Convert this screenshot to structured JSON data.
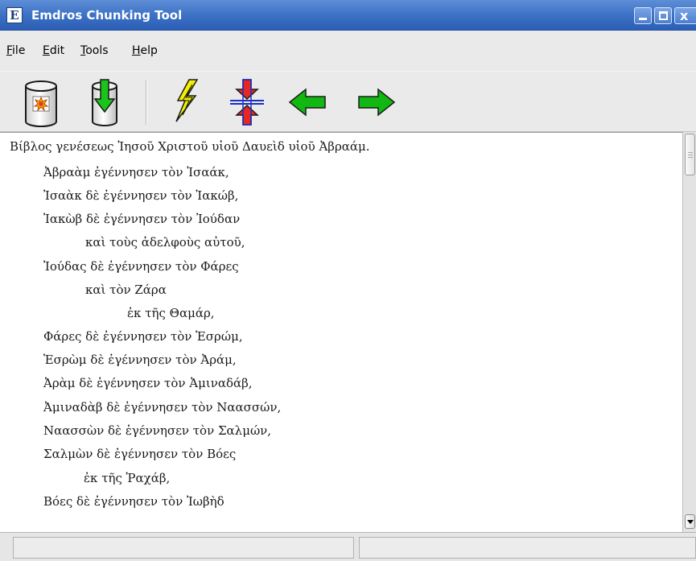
{
  "window": {
    "logo_letter": "E",
    "title": "Emdros Chunking Tool",
    "controls": {
      "close_glyph": "x"
    }
  },
  "menubar": {
    "items": [
      {
        "label": "File",
        "mnemonic": "F",
        "rest": "ile"
      },
      {
        "label": "Edit",
        "mnemonic": "E",
        "rest": "dit"
      },
      {
        "label": "Tools",
        "mnemonic": "T",
        "rest": "ools"
      },
      {
        "label": "Help",
        "mnemonic": "H",
        "rest": "elp"
      }
    ]
  },
  "toolbar": {
    "buttons": [
      {
        "icon": "database-icon"
      },
      {
        "icon": "load-down-arrow-icon"
      },
      {
        "icon": "lightning-icon"
      },
      {
        "icon": "split-merge-arrows-icon"
      },
      {
        "icon": "back-arrow-icon"
      },
      {
        "icon": "forward-arrow-icon"
      }
    ],
    "colors": {
      "arrow_green": "#11b811",
      "lightning_yellow": "#f5f000",
      "split_red": "#e42828",
      "split_blue": "#1b2fc4"
    }
  },
  "text": {
    "lines": [
      {
        "text": "Βίβλος γενέσεως Ἰησοῦ Χριστοῦ υἱοῦ Δαυεὶδ υἱοῦ Ἀβραάμ.",
        "indent": 0
      },
      {
        "text": "Ἀβραὰμ ἐγέννησεν τὸν Ἰσαάκ,",
        "indent": 1
      },
      {
        "text": "Ἰσαὰκ δὲ ἐγέννησεν τὸν Ἰακώβ,",
        "indent": 1
      },
      {
        "text": "Ἰακὼβ δὲ ἐγέννησεν τὸν Ἰούδαν",
        "indent": 1
      },
      {
        "text": "καὶ τοὺς ἀδελφοὺς αὐτοῦ,",
        "indent": 2
      },
      {
        "text": "Ἰούδας δὲ ἐγέννησεν τὸν Φάρες",
        "indent": 1
      },
      {
        "text": "καὶ τὸν Ζάρα",
        "indent": 2
      },
      {
        "text": "ἐκ τῆς Θαμάρ,",
        "indent": 3
      },
      {
        "text": "Φάρες δὲ ἐγέννησεν τὸν Ἑσρώμ,",
        "indent": 1
      },
      {
        "text": "Ἑσρὼμ δὲ ἐγέννησεν τὸν Ἀράμ,",
        "indent": 1
      },
      {
        "text": "Ἀρὰμ δὲ ἐγέννησεν τὸν Ἀμιναδάβ,",
        "indent": 1
      },
      {
        "text": "Ἀμιναδὰβ δὲ ἐγέννησεν τὸν Ναασσών,",
        "indent": 1
      },
      {
        "text": "Ναασσὼν δὲ ἐγέννησεν τὸν Σαλμών,",
        "indent": 1
      },
      {
        "text": "Σαλμὼν δὲ ἐγέννησεν τὸν Βόες",
        "indent": 1
      },
      {
        "text": "ἐκ τῆς Ῥαχάβ,",
        "indent": 2
      },
      {
        "text": "Βόες δὲ ἐγέννησεν τὸν Ἰωβὴδ",
        "indent": 1
      }
    ]
  },
  "statusbar": {
    "left": "",
    "right": ""
  }
}
